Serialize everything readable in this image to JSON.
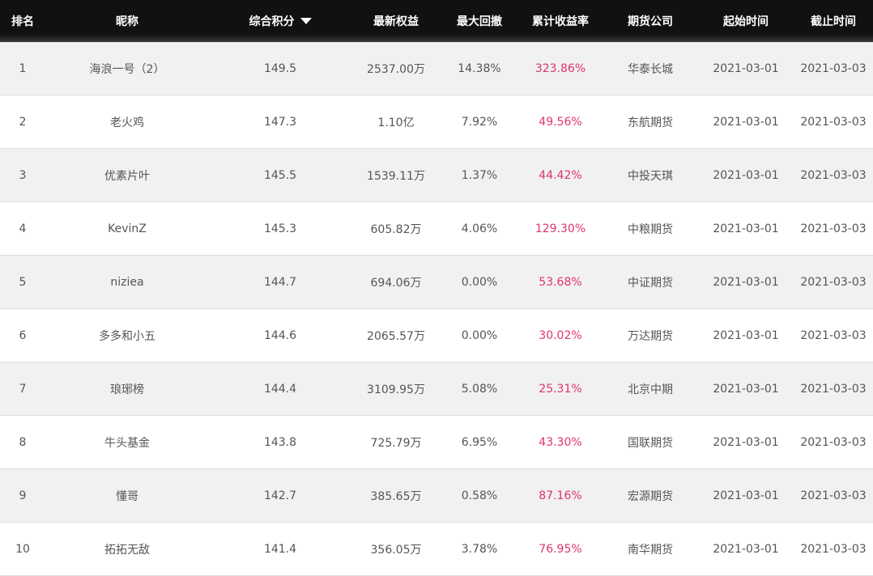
{
  "headers": {
    "rank": "排名",
    "name": "昵称",
    "score": "综合积分",
    "equity": "最新权益",
    "drawdown": "最大回撤",
    "return": "累计收益率",
    "company": "期货公司",
    "start": "起始时间",
    "end": "截止时间"
  },
  "sort_icon": "caret-down-icon",
  "colors": {
    "header_bg": "#111111",
    "return_text": "#e0336e",
    "row_alt_bg": "#f1f1f1"
  },
  "rows": [
    {
      "rank": "1",
      "name": "海浪一号（2）",
      "score": "149.5",
      "equity": "2537.00万",
      "drawdown": "14.38%",
      "return": "323.86%",
      "company": "华泰长城",
      "start": "2021-03-01",
      "end": "2021-03-03"
    },
    {
      "rank": "2",
      "name": "老火鸡",
      "score": "147.3",
      "equity": "1.10亿",
      "drawdown": "7.92%",
      "return": "49.56%",
      "company": "东航期货",
      "start": "2021-03-01",
      "end": "2021-03-03"
    },
    {
      "rank": "3",
      "name": "优素片叶",
      "score": "145.5",
      "equity": "1539.11万",
      "drawdown": "1.37%",
      "return": "44.42%",
      "company": "中投天琪",
      "start": "2021-03-01",
      "end": "2021-03-03"
    },
    {
      "rank": "4",
      "name": "KevinZ",
      "score": "145.3",
      "equity": "605.82万",
      "drawdown": "4.06%",
      "return": "129.30%",
      "company": "中粮期货",
      "start": "2021-03-01",
      "end": "2021-03-03"
    },
    {
      "rank": "5",
      "name": "niziea",
      "score": "144.7",
      "equity": "694.06万",
      "drawdown": "0.00%",
      "return": "53.68%",
      "company": "中证期货",
      "start": "2021-03-01",
      "end": "2021-03-03"
    },
    {
      "rank": "6",
      "name": "多多和小五",
      "score": "144.6",
      "equity": "2065.57万",
      "drawdown": "0.00%",
      "return": "30.02%",
      "company": "万达期货",
      "start": "2021-03-01",
      "end": "2021-03-03"
    },
    {
      "rank": "7",
      "name": "琅琊榜",
      "score": "144.4",
      "equity": "3109.95万",
      "drawdown": "5.08%",
      "return": "25.31%",
      "company": "北京中期",
      "start": "2021-03-01",
      "end": "2021-03-03"
    },
    {
      "rank": "8",
      "name": "牛头基金",
      "score": "143.8",
      "equity": "725.79万",
      "drawdown": "6.95%",
      "return": "43.30%",
      "company": "国联期货",
      "start": "2021-03-01",
      "end": "2021-03-03"
    },
    {
      "rank": "9",
      "name": "懂哥",
      "score": "142.7",
      "equity": "385.65万",
      "drawdown": "0.58%",
      "return": "87.16%",
      "company": "宏源期货",
      "start": "2021-03-01",
      "end": "2021-03-03"
    },
    {
      "rank": "10",
      "name": "拓拓无敌",
      "score": "141.4",
      "equity": "356.05万",
      "drawdown": "3.78%",
      "return": "76.95%",
      "company": "南华期货",
      "start": "2021-03-01",
      "end": "2021-03-03"
    }
  ]
}
